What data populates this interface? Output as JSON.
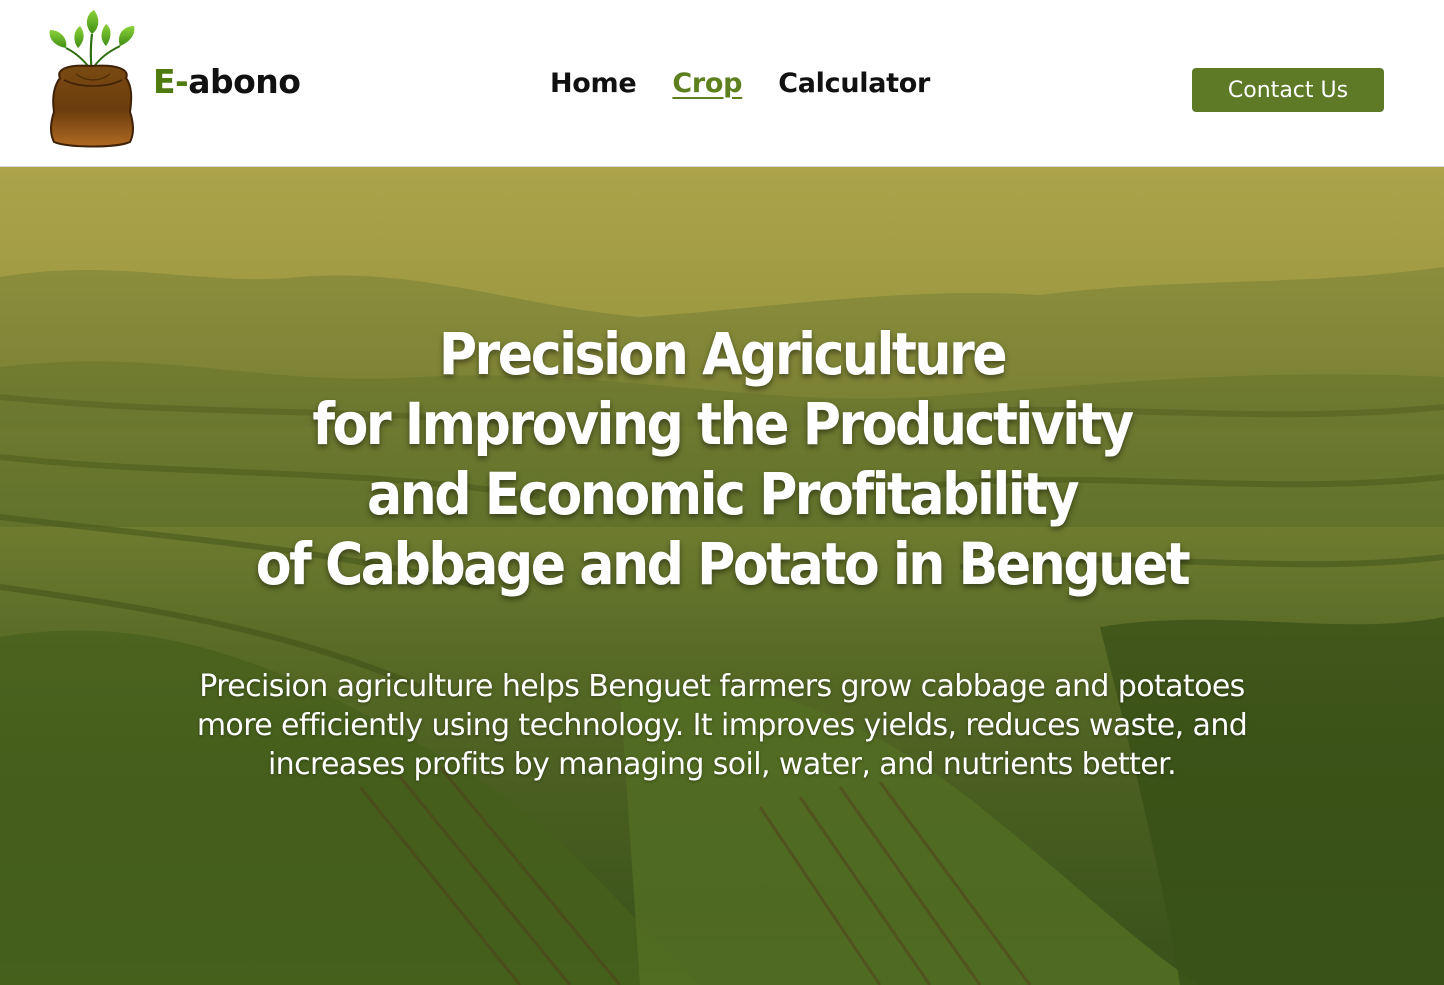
{
  "brand": {
    "prefix": "E-",
    "name": "abono",
    "logo_icon": "fertilizer-sack-sprout-icon"
  },
  "nav": {
    "items": [
      {
        "label": "Home",
        "active": false
      },
      {
        "label": "Crop",
        "active": true
      },
      {
        "label": "Calculator",
        "active": false
      }
    ]
  },
  "contact_button": {
    "label": "Contact Us"
  },
  "hero": {
    "title_lines": [
      "Precision Agriculture",
      "for Improving the Productivity",
      "and Economic Profitability",
      "of Cabbage and Potato in Benguet"
    ],
    "description_lines": [
      "Precision agriculture helps Benguet farmers grow cabbage and potatoes",
      "more efficiently using technology. It improves yields, reduces waste, and",
      "increases profits by managing soil, water, and nutrients better."
    ]
  },
  "colors": {
    "accent": "#5e7a26",
    "brand_accent": "#4f7a10",
    "active_link": "#5d7f1e"
  }
}
